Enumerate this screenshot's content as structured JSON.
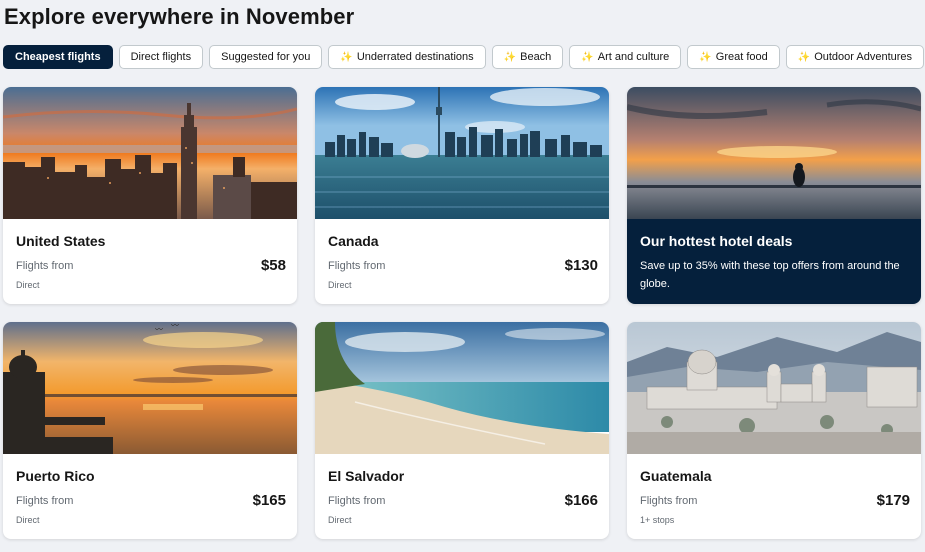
{
  "page": {
    "title": "Explore everywhere in November"
  },
  "filters": [
    {
      "label": "Cheapest flights",
      "active": true,
      "sparkle": false
    },
    {
      "label": "Direct flights",
      "active": false,
      "sparkle": false
    },
    {
      "label": "Suggested for you",
      "active": false,
      "sparkle": false
    },
    {
      "label": "Underrated destinations",
      "active": false,
      "sparkle": true
    },
    {
      "label": "Beach",
      "active": false,
      "sparkle": true
    },
    {
      "label": "Art and culture",
      "active": false,
      "sparkle": true
    },
    {
      "label": "Great food",
      "active": false,
      "sparkle": true
    },
    {
      "label": "Outdoor Adventures",
      "active": false,
      "sparkle": true
    }
  ],
  "sparkle_glyph": "✨",
  "destinations": [
    {
      "name": "United States",
      "from_label": "Flights from",
      "price": "$58",
      "stops": "Direct",
      "image": "new-york-skyline"
    },
    {
      "name": "Canada",
      "from_label": "Flights from",
      "price": "$130",
      "stops": "Direct",
      "image": "toronto-skyline"
    },
    {
      "name": "Puerto Rico",
      "from_label": "Flights from",
      "price": "$165",
      "stops": "Direct",
      "image": "sunset-fort"
    },
    {
      "name": "El Salvador",
      "from_label": "Flights from",
      "price": "$166",
      "stops": "Direct",
      "image": "sandy-beach"
    },
    {
      "name": "Guatemala",
      "from_label": "Flights from",
      "price": "$179",
      "stops": "1+ stops",
      "image": "colonial-city"
    }
  ],
  "hotel_deals": {
    "title": "Our hottest hotel deals",
    "description": "Save up to 35% with these top offers from around the globe.",
    "image": "infinity-pool-sunset"
  },
  "colors": {
    "brand_dark": "#05203c",
    "background": "#eff1f5",
    "muted_text": "#626971"
  }
}
